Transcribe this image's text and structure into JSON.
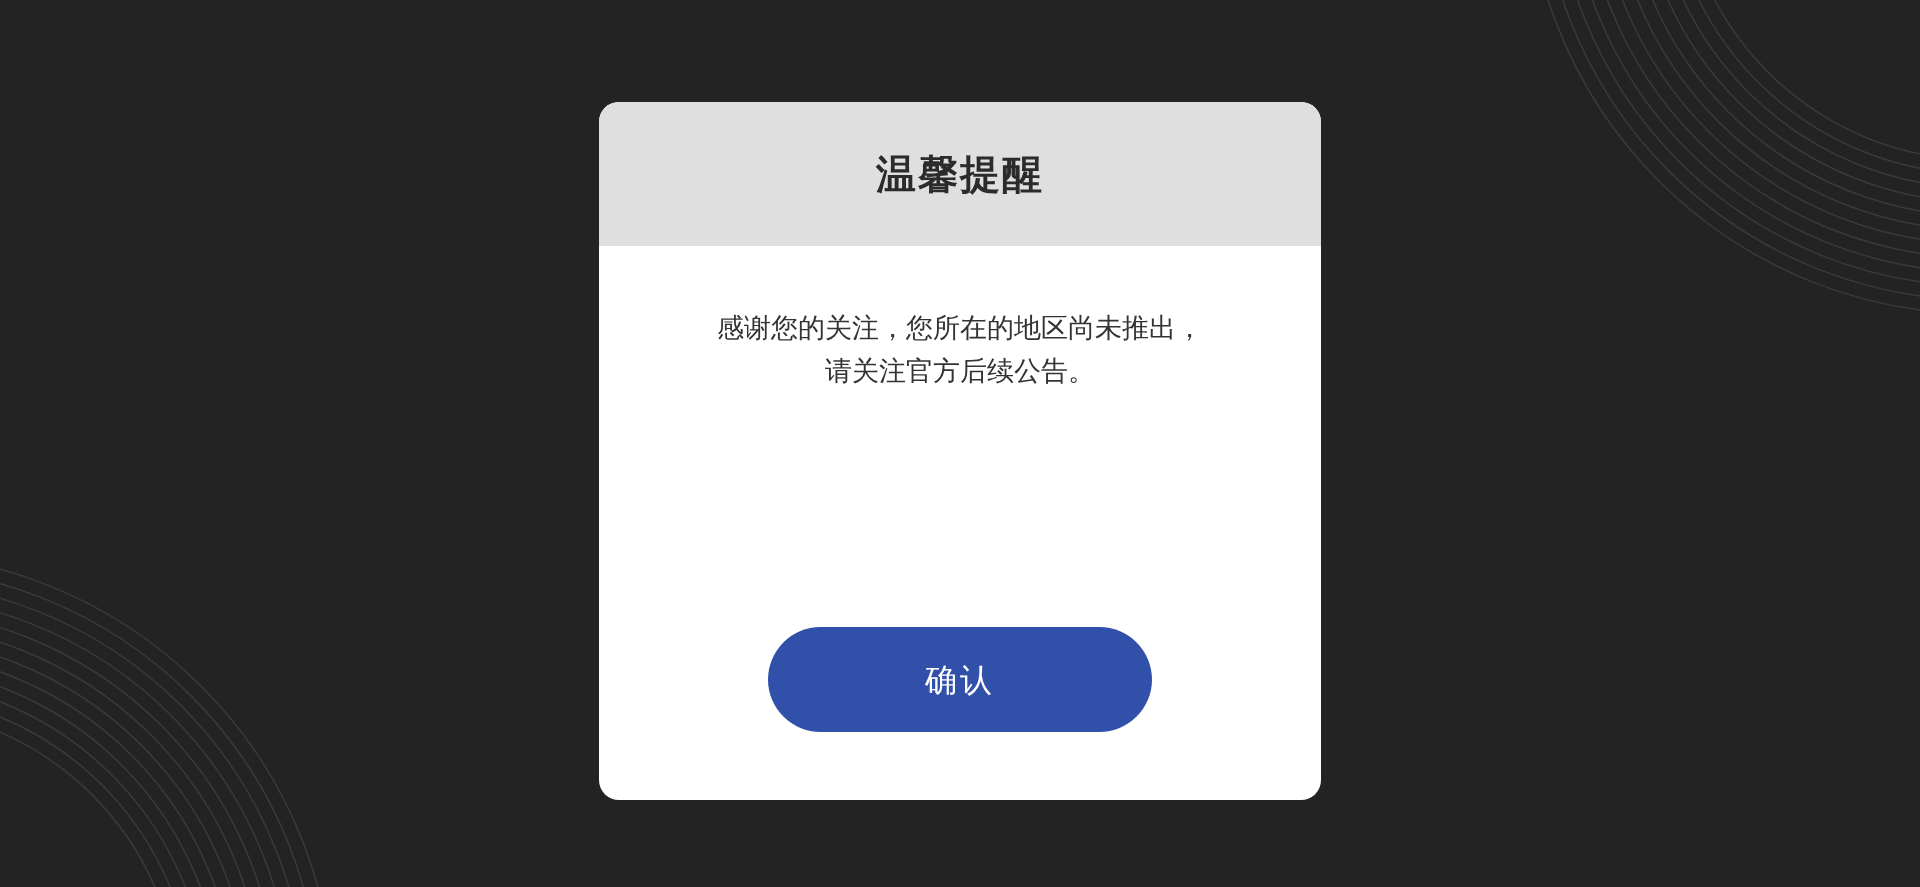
{
  "dialog": {
    "title": "温馨提醒",
    "message_lines": [
      "感谢您的关注，您所在的地区尚未推出，",
      "请关注官方后续公告。"
    ],
    "buttons": [
      "确认"
    ]
  }
}
